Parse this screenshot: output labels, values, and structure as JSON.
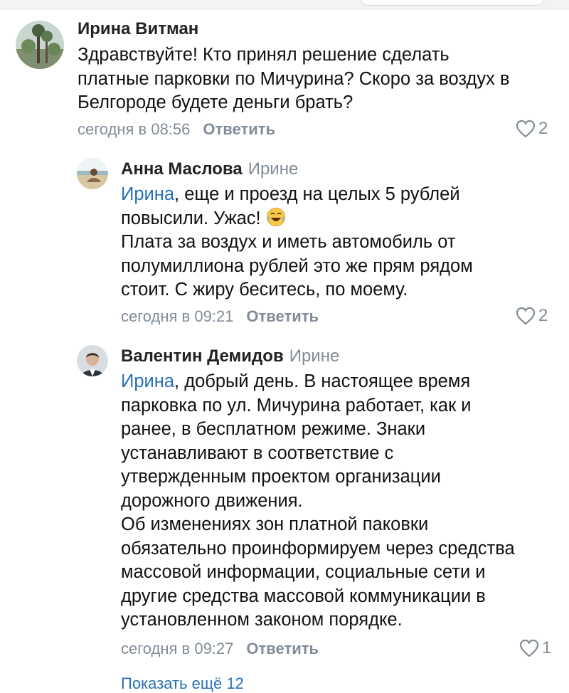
{
  "comments": [
    {
      "author": "Ирина Витман",
      "reply_to": "",
      "mention": "",
      "text": "Здравствуйте! Кто принял решение сделать\nплатные парковки по Мичурина? Скоро за воздух в\nБелгороде будете деньги брать?",
      "time": "сегодня в 08:56",
      "reply_label": "Ответить",
      "likes": "2"
    },
    {
      "author": "Анна Маслова",
      "reply_to": "Ирине",
      "mention": "Ирина",
      "text_after_mention": ", еще и проезд на целых 5 рублей\nповысили. Ужас!",
      "text_rest": "Плата за воздух и иметь автомобиль от\nполумиллиона рублей это же прям рядом\nстоит. С жиру беситесь, по моему.",
      "emoji": "laughing-tears-emoji",
      "time": "сегодня в 09:21",
      "reply_label": "Ответить",
      "likes": "2"
    },
    {
      "author": "Валентин Демидов",
      "reply_to": "Ирине",
      "mention": "Ирина",
      "text_after_mention": ", добрый день. В настоящее время\nпарковка по ул. Мичурина работает, как и\nранее, в бесплатном режиме. Знаки\nустанавливают в соответствие с\nутвержденным проектом организации\nдорожного движения.\nОб изменениях зон платной паковки\nобязательно проинформируем через средства\nмассовой информации, социальные сети и\nдругие средства массовой коммуникации в\nустановленном законом порядке.",
      "time": "сегодня в 09:27",
      "reply_label": "Ответить",
      "likes": "1"
    }
  ],
  "more_replies": "Показать ещё 12",
  "colors": {
    "meta": "#818c99",
    "mention": "#2a6fb8",
    "text": "#111111"
  },
  "icons": {
    "like": "heart-outline-icon"
  }
}
